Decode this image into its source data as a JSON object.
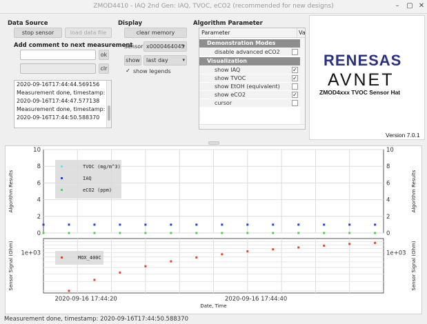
{
  "window": {
    "title": "ZMOD4410 - IAQ 2nd Gen: IAQ, TVOC, eCO2 (recommended for new designs)"
  },
  "data_source": {
    "title": "Data Source",
    "stop_label": "stop sensor",
    "load_label": "load data file",
    "comment_title": "Add comment to next measurement",
    "comment_value": "",
    "ok_label": "ok",
    "clr_label": "clr",
    "log": [
      "2020-09-16T17:44:44.569156",
      "Measurement done, timestamp:",
      "2020-09-16T17:44:47.577138",
      "Measurement done, timestamp:",
      "2020-09-16T17:44:50.588370"
    ]
  },
  "display": {
    "title": "Display",
    "clear_label": "clear memory",
    "sensor_label": "Sensor:",
    "sensor_value": "x0000464045",
    "show_label": "show",
    "period_value": "last day",
    "legends_label": "show legends",
    "legends_checked": true
  },
  "algo": {
    "title": "Algorithm Parameter",
    "col_param": "Parameter",
    "col_value": "Va",
    "groups": [
      {
        "name": "Demonstration Modes",
        "items": [
          {
            "label": "disable advanced eCO2 algorithm",
            "checked": false
          }
        ]
      },
      {
        "name": "Visualization",
        "items": [
          {
            "label": "show IAQ",
            "checked": true
          },
          {
            "label": "show TVOC",
            "checked": true
          },
          {
            "label": "show EtOH (equivalent)",
            "checked": false
          },
          {
            "label": "show eCO2",
            "checked": true
          },
          {
            "label": "cursor",
            "checked": false
          }
        ]
      }
    ]
  },
  "logo": {
    "brand1": "RENESAS",
    "brand2": "AVNET",
    "product": "ZMOD4xxx TVOC Sensor Hat",
    "version": "Version 7.0.1",
    "colors": {
      "renesas": "#2a2f86",
      "avnet": "#111111"
    }
  },
  "chart_data": [
    {
      "type": "scatter",
      "title": "",
      "ylabel": "Algorithm Results",
      "ylabel_right": "Algorithm Results",
      "ylim": [
        0,
        10
      ],
      "yticks": [
        "0",
        "2",
        "4",
        "6",
        "8",
        "10"
      ],
      "legend": "top-left",
      "grid": true,
      "series": [
        {
          "name": "TVOC (mg/m^3)",
          "color": "#7fd8e8",
          "x": [],
          "y": []
        },
        {
          "name": "IAQ",
          "color": "#1f3fe0",
          "x": [
            0,
            3,
            6,
            9,
            12,
            15,
            18,
            21,
            24,
            27,
            30,
            33,
            36,
            39
          ],
          "y": [
            1,
            1,
            1,
            1,
            1,
            1,
            1,
            1,
            1,
            1,
            1,
            1,
            1,
            1
          ]
        },
        {
          "name": "eCO2 (ppm)",
          "color": "#5cc85c",
          "x": [
            0,
            3,
            6,
            9,
            12,
            15,
            18,
            21,
            24,
            27,
            30,
            33,
            36,
            39
          ],
          "y": [
            0,
            0,
            0,
            0,
            0,
            0,
            0,
            0,
            0,
            0,
            0,
            0,
            0,
            0
          ]
        }
      ]
    },
    {
      "type": "scatter",
      "title": "",
      "xlabel": "Date, Time",
      "ylabel": "Sensor Signal (Ohm)",
      "ylabel_right": "Sensor Signal (Ohm)",
      "yscale": "log",
      "yticks": [
        "1e+03"
      ],
      "xticks": [
        "2020-09-16 17:44:20",
        "2020-09-16 17:44:40"
      ],
      "legend": "top-left",
      "grid": true,
      "series": [
        {
          "name": "MOX_400C",
          "color": "#e0462a",
          "x": [
            3,
            6,
            9,
            12,
            15,
            18,
            21,
            24,
            27,
            30,
            33,
            36,
            39
          ],
          "y": [
            400,
            520,
            620,
            720,
            810,
            890,
            960,
            1030,
            1080,
            1130,
            1180,
            1230,
            1260
          ]
        }
      ]
    }
  ],
  "status": "Measurement done, timestamp: 2020-09-16T17:44:50.588370"
}
